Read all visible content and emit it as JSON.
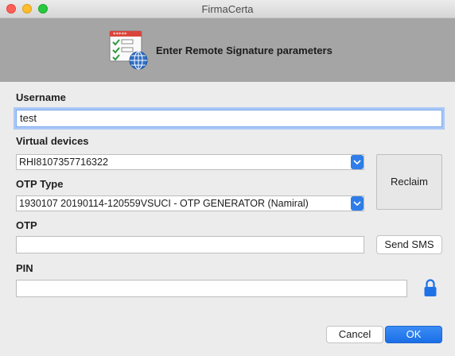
{
  "window": {
    "title": "FirmaCerta"
  },
  "header": {
    "title": "Enter Remote Signature parameters",
    "icon": "certificate-list-globe-icon",
    "stars": "*****"
  },
  "form": {
    "username_label": "Username",
    "username_value": "test",
    "virtual_devices_label": "Virtual devices",
    "virtual_devices_value": "RHI8107357716322",
    "otp_type_label": "OTP Type",
    "otp_type_value": "1930107 20190114-120559VSUCI - OTP GENERATOR (Namiral)",
    "otp_label": "OTP",
    "otp_value": "",
    "pin_label": "PIN",
    "pin_value": ""
  },
  "buttons": {
    "reclaim": "Reclaim",
    "send_sms": "Send SMS",
    "cancel": "Cancel",
    "ok": "OK"
  },
  "colors": {
    "accent": "#2f7de8",
    "header_bg": "#a5a5a5",
    "focus_ring": "#a9c8f6"
  }
}
